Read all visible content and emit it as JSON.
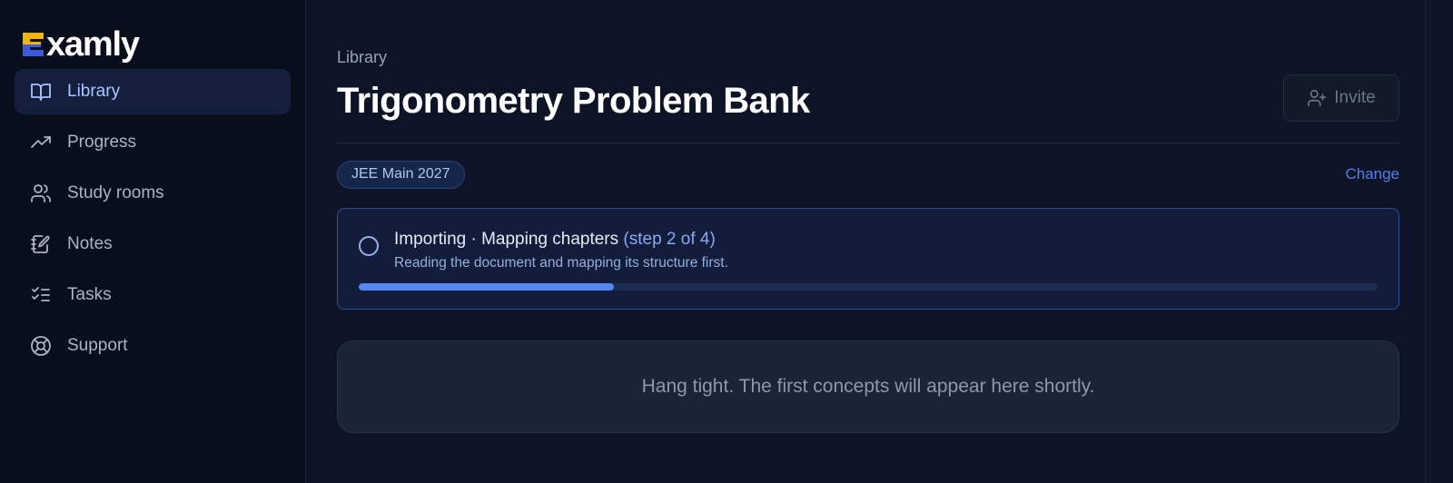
{
  "app": {
    "name": "Examly",
    "logo_letter": "E",
    "logo_rest": "xamly",
    "colors": {
      "logo_top": "#f4b400",
      "logo_bottom": "#3b5bdb",
      "accent": "#4f7ff2"
    }
  },
  "sidebar": {
    "items": [
      {
        "label": "Library",
        "icon": "book-open-icon",
        "active": true
      },
      {
        "label": "Progress",
        "icon": "trending-up-icon",
        "active": false
      },
      {
        "label": "Study rooms",
        "icon": "users-icon",
        "active": false
      },
      {
        "label": "Notes",
        "icon": "notebook-pen-icon",
        "active": false
      },
      {
        "label": "Tasks",
        "icon": "list-checks-icon",
        "active": false
      },
      {
        "label": "Support",
        "icon": "life-buoy-icon",
        "active": false
      }
    ]
  },
  "header": {
    "breadcrumb": "Library",
    "title": "Trigonometry Problem Bank",
    "invite_label": "Invite"
  },
  "exam": {
    "tag": "JEE Main 2027",
    "change_label": "Change"
  },
  "import": {
    "status": "Importing · Mapping chapters",
    "step": "(step 2 of 4)",
    "description": "Reading the document and mapping its structure first.",
    "progress_fraction": 0.25
  },
  "empty_state": {
    "message": "Hang tight. The first concepts will appear here shortly."
  }
}
